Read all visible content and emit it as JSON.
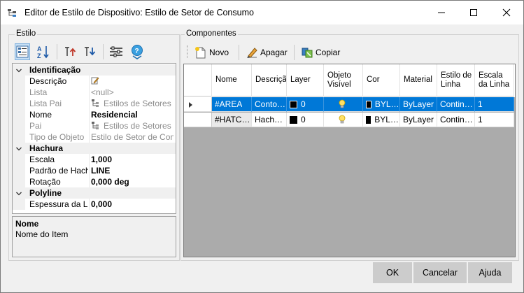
{
  "window": {
    "title": "Editor de Estilo de Dispositivo: Estilo de Setor de Consumo"
  },
  "left_panel": {
    "label": "Estilo",
    "properties": [
      {
        "type": "category",
        "name": "Identificação"
      },
      {
        "type": "prop",
        "name": "Descrição",
        "value": "",
        "style": "normal",
        "icon": "edit-icon"
      },
      {
        "type": "prop",
        "name": "Lista",
        "value": "<null>",
        "style": "gray"
      },
      {
        "type": "prop",
        "name": "Lista Pai",
        "value": "Estilos de Setores",
        "style": "gray",
        "icon": "style-list-icon"
      },
      {
        "type": "prop",
        "name": "Nome",
        "value": "Residencial",
        "style": "bold"
      },
      {
        "type": "prop",
        "name": "Pai",
        "value": "Estilos de Setores",
        "style": "gray",
        "icon": "style-list-icon"
      },
      {
        "type": "prop",
        "name": "Tipo de Objeto",
        "value": "Estilo de Setor de Consumo",
        "style": "gray"
      },
      {
        "type": "category",
        "name": "Hachura"
      },
      {
        "type": "prop",
        "name": "Escala",
        "value": "1,000",
        "style": "bold"
      },
      {
        "type": "prop",
        "name": "Padrão de Hachura",
        "value": "LINE",
        "style": "bold"
      },
      {
        "type": "prop",
        "name": "Rotação",
        "value": "0,000 deg",
        "style": "bold"
      },
      {
        "type": "category",
        "name": "Polyline"
      },
      {
        "type": "prop",
        "name": "Espessura da Linha",
        "value": "0,000",
        "style": "bold"
      }
    ],
    "description": {
      "title": "Nome",
      "text": "Nome do Item"
    }
  },
  "right_panel": {
    "label": "Componentes",
    "toolbar": {
      "new_label": "Novo",
      "delete_label": "Apagar",
      "copy_label": "Copiar"
    },
    "columns": [
      "Nome",
      "Descrição",
      "Layer",
      "Objeto Visível",
      "Cor",
      "Material",
      "Estilo de Linha",
      "Escala da Linha"
    ],
    "rows": [
      {
        "nome": "#AREA",
        "descricao": "Contorno...",
        "layer": "0",
        "cor": "BYLAYER",
        "material": "ByLayer",
        "estilo_linha": "Continuous",
        "escala": "1",
        "selected": true
      },
      {
        "nome": "#HATCH...",
        "descricao": "Hachura",
        "layer": "0",
        "cor": "BYLAYER",
        "material": "ByLayer",
        "estilo_linha": "Continuous",
        "escala": "1",
        "selected": false
      }
    ]
  },
  "footer": {
    "ok_label": "OK",
    "cancel_label": "Cancelar",
    "help_label": "Ajuda"
  }
}
